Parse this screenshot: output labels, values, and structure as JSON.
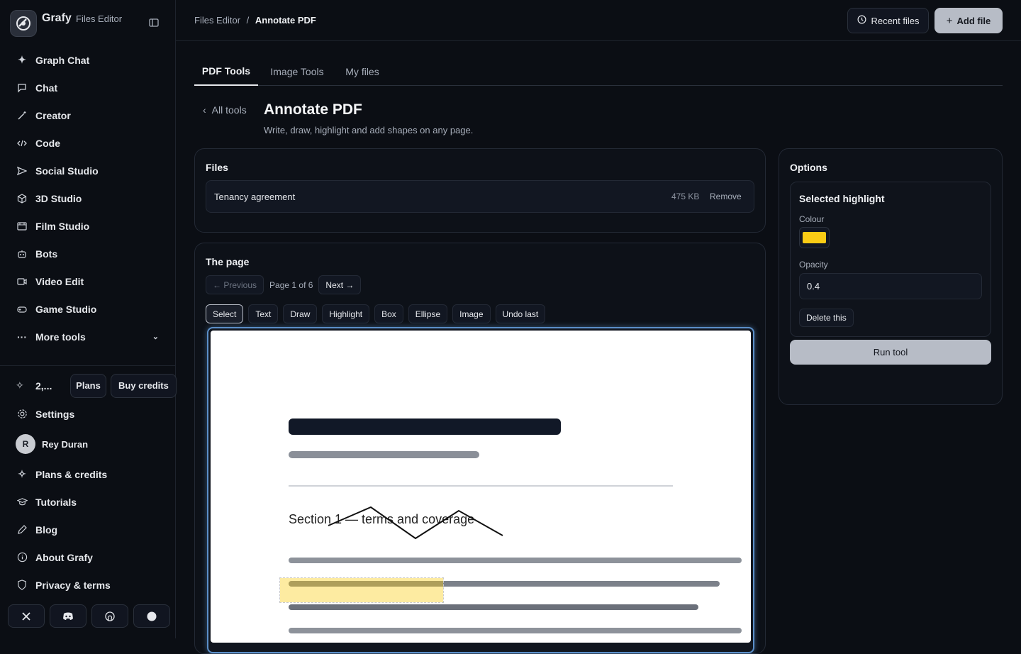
{
  "brand": {
    "name": "Grafy",
    "subtitle": "Files Editor"
  },
  "sidebar": {
    "items": [
      {
        "label": "Graph Chat",
        "icon": "sparkle-icon"
      },
      {
        "label": "Chat",
        "icon": "chat-icon"
      },
      {
        "label": "Creator",
        "icon": "wand-icon"
      },
      {
        "label": "Code",
        "icon": "code-icon"
      },
      {
        "label": "Social Studio",
        "icon": "send-icon"
      },
      {
        "label": "3D Studio",
        "icon": "cube-icon"
      },
      {
        "label": "Film Studio",
        "icon": "film-icon"
      },
      {
        "label": "Bots",
        "icon": "bot-icon"
      },
      {
        "label": "Video Edit",
        "icon": "video-icon"
      },
      {
        "label": "Game Studio",
        "icon": "gamepad-icon"
      },
      {
        "label": "More tools",
        "icon": "ellipsis-icon"
      }
    ],
    "credits": {
      "value": "2,...",
      "plans_label": "Plans",
      "buy_label": "Buy credits"
    },
    "settings_label": "Settings",
    "user": {
      "initial": "R",
      "name": "Rey Duran"
    },
    "bottom_items": [
      {
        "label": "Plans & credits",
        "icon": "sparkle-icon"
      },
      {
        "label": "Tutorials",
        "icon": "graduation-cap-icon"
      },
      {
        "label": "Blog",
        "icon": "pen-icon"
      },
      {
        "label": "About Grafy",
        "icon": "info-icon"
      },
      {
        "label": "Privacy & terms",
        "icon": "shield-icon"
      }
    ],
    "socials": [
      "x-icon",
      "discord-icon",
      "github-icon",
      "circle-icon"
    ]
  },
  "header": {
    "breadcrumb_parent": "Files Editor",
    "breadcrumb_sep": "/",
    "breadcrumb_current": "Annotate PDF",
    "recent_label": "Recent files",
    "add_label": "Add file"
  },
  "tabs": [
    "PDF Tools",
    "Image Tools",
    "My files"
  ],
  "tool_header": {
    "back_label": "All tools",
    "title": "Annotate PDF",
    "subtitle": "Write, draw, highlight and add shapes on any page."
  },
  "files": {
    "heading": "Files",
    "name": "Tenancy agreement",
    "size": "475 KB",
    "remove_label": "Remove"
  },
  "page": {
    "heading": "The page",
    "prev_label": "← Previous",
    "page_info": "Page 1 of 6",
    "next_label": "Next →",
    "tools": [
      "Select",
      "Text",
      "Draw",
      "Highlight",
      "Box",
      "Ellipse",
      "Image",
      "Undo last"
    ],
    "active_tool": "Select",
    "document_text": "Section 1 — terms and coverage",
    "highlight_color": "#facc15"
  },
  "options": {
    "heading": "Options",
    "panel_title": "Selected highlight",
    "colour_label": "Colour",
    "colour_value": "#facc15",
    "opacity_label": "Opacity",
    "opacity_value": "0.4",
    "delete_label": "Delete this",
    "run_label": "Run tool"
  }
}
